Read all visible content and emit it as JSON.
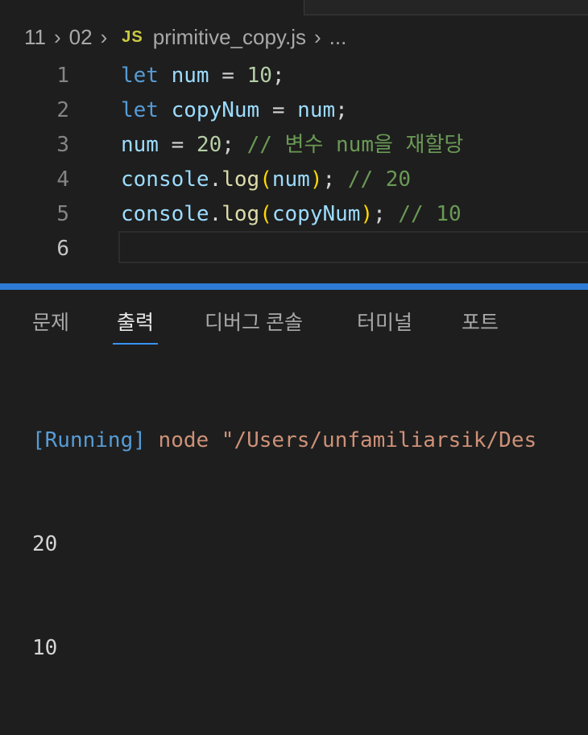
{
  "breadcrumb": {
    "items": [
      "11",
      "02"
    ],
    "file_icon": "JS",
    "file_name": "primitive_copy.js",
    "ellipsis": "..."
  },
  "editor": {
    "active_line": 6,
    "lines": [
      {
        "number": "1",
        "tokens": [
          {
            "text": "let",
            "type": "keyword"
          },
          {
            "text": " ",
            "type": "plain"
          },
          {
            "text": "num",
            "type": "variable"
          },
          {
            "text": " = ",
            "type": "operator"
          },
          {
            "text": "10",
            "type": "number"
          },
          {
            "text": ";",
            "type": "operator"
          }
        ]
      },
      {
        "number": "2",
        "tokens": [
          {
            "text": "let",
            "type": "keyword"
          },
          {
            "text": " ",
            "type": "plain"
          },
          {
            "text": "copyNum",
            "type": "variable"
          },
          {
            "text": " = ",
            "type": "operator"
          },
          {
            "text": "num",
            "type": "variable"
          },
          {
            "text": ";",
            "type": "operator"
          }
        ]
      },
      {
        "number": "3",
        "tokens": [
          {
            "text": "num",
            "type": "variable"
          },
          {
            "text": " = ",
            "type": "operator"
          },
          {
            "text": "20",
            "type": "number"
          },
          {
            "text": "; ",
            "type": "operator"
          },
          {
            "text": "// 변수 num을 재할당",
            "type": "comment"
          }
        ]
      },
      {
        "number": "4",
        "tokens": [
          {
            "text": "console",
            "type": "variable"
          },
          {
            "text": ".",
            "type": "operator"
          },
          {
            "text": "log",
            "type": "function"
          },
          {
            "text": "(",
            "type": "bracket"
          },
          {
            "text": "num",
            "type": "variable"
          },
          {
            "text": ")",
            "type": "bracket"
          },
          {
            "text": "; ",
            "type": "operator"
          },
          {
            "text": "// 20",
            "type": "comment"
          }
        ]
      },
      {
        "number": "5",
        "tokens": [
          {
            "text": "console",
            "type": "variable"
          },
          {
            "text": ".",
            "type": "operator"
          },
          {
            "text": "log",
            "type": "function"
          },
          {
            "text": "(",
            "type": "bracket"
          },
          {
            "text": "copyNum",
            "type": "variable"
          },
          {
            "text": ")",
            "type": "bracket"
          },
          {
            "text": "; ",
            "type": "operator"
          },
          {
            "text": "// 10",
            "type": "comment"
          }
        ]
      },
      {
        "number": "6",
        "tokens": []
      }
    ]
  },
  "panel": {
    "tabs": [
      "문제",
      "출력",
      "디버그 콘솔",
      "터미널",
      "포트"
    ],
    "active_tab": "출력"
  },
  "output": {
    "running_tag": "[Running]",
    "command": " node \"/Users/unfamiliarsik/Des",
    "lines": [
      "20",
      "10"
    ]
  },
  "colors": {
    "background": "#1e1e1e",
    "panel_border": "#2e7bd6",
    "keyword": "#569cd6",
    "variable": "#9cdcfe",
    "number": "#b5cea8",
    "comment": "#6a9955",
    "function": "#dcdcaa",
    "bracket": "#ffd700",
    "string": "#ce9178"
  }
}
